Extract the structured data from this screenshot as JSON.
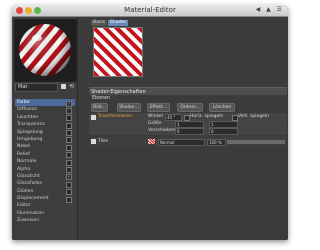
{
  "window": {
    "title": "Material-Editor",
    "toolbar_icons": "◀ ▲ ☰"
  },
  "left": {
    "material_name": "Mat",
    "channels": [
      {
        "label": "Farbe",
        "checked": true,
        "selected": true
      },
      {
        "label": "Diffusion",
        "checked": false
      },
      {
        "label": "Leuchten",
        "checked": false
      },
      {
        "label": "Transparenz",
        "checked": false
      },
      {
        "label": "Spiegelung",
        "checked": false
      },
      {
        "label": "Umgebung",
        "checked": false
      },
      {
        "label": "Nebel",
        "checked": false
      },
      {
        "label": "Relief",
        "checked": false
      },
      {
        "label": "Normale",
        "checked": false
      },
      {
        "label": "Alpha",
        "checked": false
      },
      {
        "label": "Glanzlicht",
        "checked": true
      },
      {
        "label": "Glanzfarbe",
        "checked": false
      },
      {
        "label": "Glühen",
        "checked": false
      },
      {
        "label": "Displacement",
        "checked": false
      },
      {
        "label": "Editor",
        "checked": null
      },
      {
        "label": "Illumination",
        "checked": null
      },
      {
        "label": "Zuweisen",
        "checked": null
      }
    ]
  },
  "right": {
    "tabs": [
      "Basis",
      "Shader"
    ],
    "section_title": "Shader-Eigenschaften",
    "ebenen_label": "Ebenen",
    "buttons": [
      "Bild...",
      "Shader...",
      "Effekt...",
      "Ordner...",
      "Löschen"
    ],
    "layer1": {
      "name": "Transformieren",
      "winkel_label": "Winkel",
      "winkel_value": "45 °",
      "horiz_label": "Horiz. spiegeln",
      "vert_label": "Vert. spiegeln",
      "groesse_label": "Größe",
      "groesse_x": "1",
      "groesse_y": "1",
      "verschieben_label": "Verschieben",
      "verschieben_x": "0",
      "verschieben_y": "0"
    },
    "layer2": {
      "name": "Tiles",
      "mode": "Normal",
      "percent": "100 %"
    }
  }
}
